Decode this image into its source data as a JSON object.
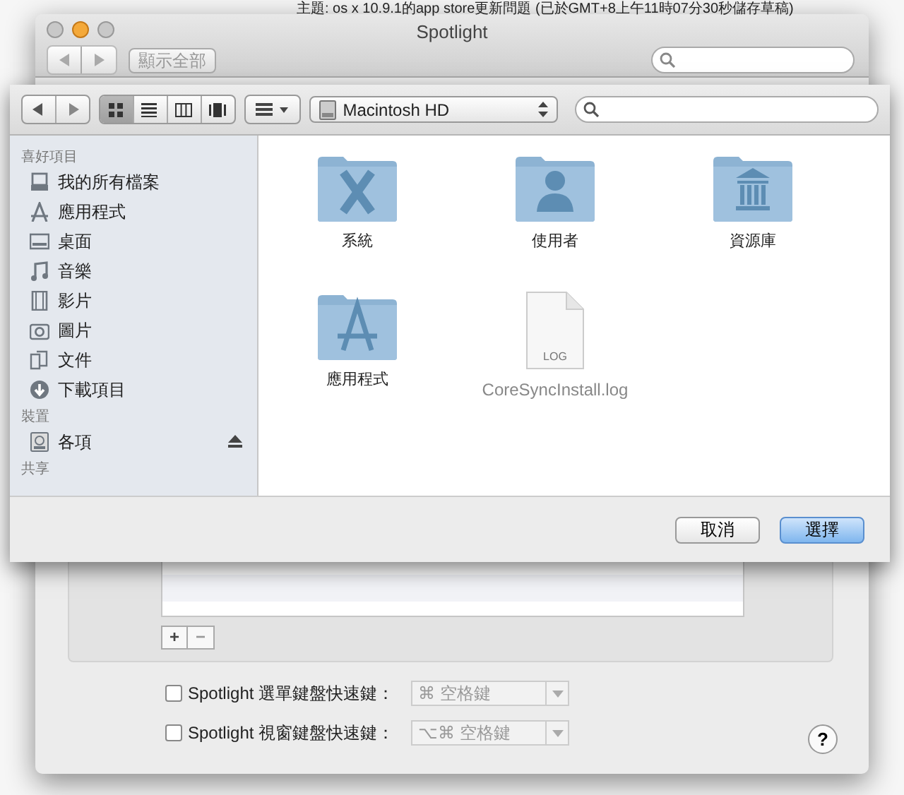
{
  "page_heading": "主題:   os x 10.9.1的app store更新問題 (已於GMT+8上午11時07分30秒儲存草稿)",
  "spotlight_window": {
    "title": "Spotlight",
    "show_all_button": "顯示全部",
    "list_buttons": [
      "+",
      "−"
    ],
    "shortcuts": [
      {
        "label": "Spotlight 選單鍵盤快速鍵：",
        "checked": false,
        "value": "⌘ 空格鍵"
      },
      {
        "label": "Spotlight 視窗鍵盤快速鍵：",
        "checked": false,
        "value": "⌥⌘ 空格鍵"
      }
    ],
    "help_button": "?"
  },
  "open_dialog": {
    "view_modes": [
      {
        "kind": "icons",
        "selected": true
      },
      {
        "kind": "list",
        "selected": false
      },
      {
        "kind": "columns",
        "selected": false
      },
      {
        "kind": "coverflow",
        "selected": false
      }
    ],
    "location": "Macintosh HD",
    "sidebar": [
      {
        "heading": "喜好項目",
        "items": [
          {
            "label": "我的所有檔案",
            "kind": "allfiles"
          },
          {
            "label": "應用程式",
            "kind": "apps"
          },
          {
            "label": "桌面",
            "kind": "desktop"
          },
          {
            "label": "音樂",
            "kind": "music"
          },
          {
            "label": "影片",
            "kind": "movies"
          },
          {
            "label": "圖片",
            "kind": "pictures"
          },
          {
            "label": "文件",
            "kind": "documents"
          },
          {
            "label": "下載項目",
            "kind": "downloads"
          }
        ]
      },
      {
        "heading": "裝置",
        "items": [
          {
            "label": "各項",
            "kind": "disk",
            "ejectable": true
          }
        ]
      },
      {
        "heading": "共享"
      }
    ],
    "files": [
      {
        "name": "系統",
        "kind": "system",
        "disabled": false
      },
      {
        "name": "使用者",
        "kind": "users",
        "disabled": false
      },
      {
        "name": "資源庫",
        "kind": "library",
        "disabled": false
      },
      {
        "name": "應用程式",
        "kind": "apps",
        "disabled": false
      },
      {
        "name": "CoreSyncInstall.log",
        "kind": "log",
        "badge": "LOG",
        "disabled": true
      }
    ],
    "buttons": [
      {
        "label": "取消",
        "default": false
      },
      {
        "label": "選擇",
        "default": true
      }
    ]
  }
}
